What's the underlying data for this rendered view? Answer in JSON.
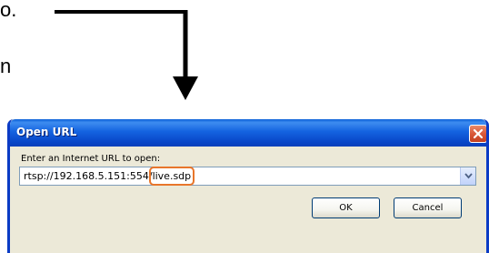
{
  "document": {
    "fragment_1": "o.",
    "fragment_2": "n"
  },
  "dialog": {
    "title": "Open URL",
    "prompt": "Enter an Internet URL to open:",
    "url_prefix": "rtsp://192.168.5.151:554/",
    "url_highlight": "live.sdp",
    "ok_label": "OK",
    "cancel_label": "Cancel"
  },
  "icons": {
    "close": "close-icon",
    "dropdown": "chevron-down-icon"
  },
  "colors": {
    "title_bar": "#0a5fd8",
    "close_button": "#d9583a",
    "highlight_box": "#e8762b",
    "dialog_face": "#ece9d8",
    "arrow": "#000000"
  }
}
